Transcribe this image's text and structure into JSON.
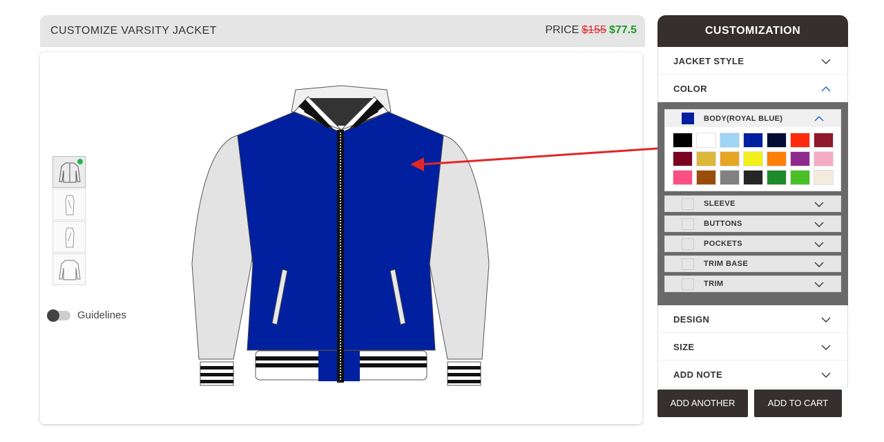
{
  "header": {
    "title": "CUSTOMIZE VARSITY JACKET",
    "price_label": "PRICE",
    "old_price": "$155",
    "new_price": "$77.5"
  },
  "guidelines": {
    "label": "Guidelines",
    "enabled": false
  },
  "views": [
    {
      "name": "front",
      "active": true
    },
    {
      "name": "left"
    },
    {
      "name": "right"
    },
    {
      "name": "back"
    }
  ],
  "panel": {
    "title": "CUSTOMIZATION",
    "sections": {
      "jacket_style": "JACKET STYLE",
      "color": "COLOR",
      "design": "DESIGN",
      "size": "SIZE",
      "add_note": "ADD NOTE"
    },
    "body": {
      "label": "BODY(ROYAL BLUE)",
      "color": "#00209f"
    },
    "parts": [
      "SLEEVE",
      "BUTTONS",
      "POCKETS",
      "TRIM BASE",
      "TRIM"
    ]
  },
  "swatches": [
    "#000000",
    "#ffffff",
    "#9fd6f5",
    "#00209f",
    "#030c34",
    "#ff2b0c",
    "#8e1a2c",
    "#7a0122",
    "#dcb73a",
    "#e7a524",
    "#f2ef1a",
    "#fd7f08",
    "#8e2b8c",
    "#f6abc5",
    "#fc4f84",
    "#9a4d09",
    "#818181",
    "#262626",
    "#1f8a2b",
    "#49c027",
    "#f3ecde"
  ],
  "buttons": {
    "add_another": "ADD ANOTHER",
    "add_to_cart": "ADD TO CART"
  },
  "colors": {
    "dark": "#352f2f",
    "accent_blue": "#00209f",
    "sleeve": "#e3e3e3",
    "price_new": "#1c9b2d",
    "price_old": "#e3262a",
    "arrow": "#e32626"
  }
}
